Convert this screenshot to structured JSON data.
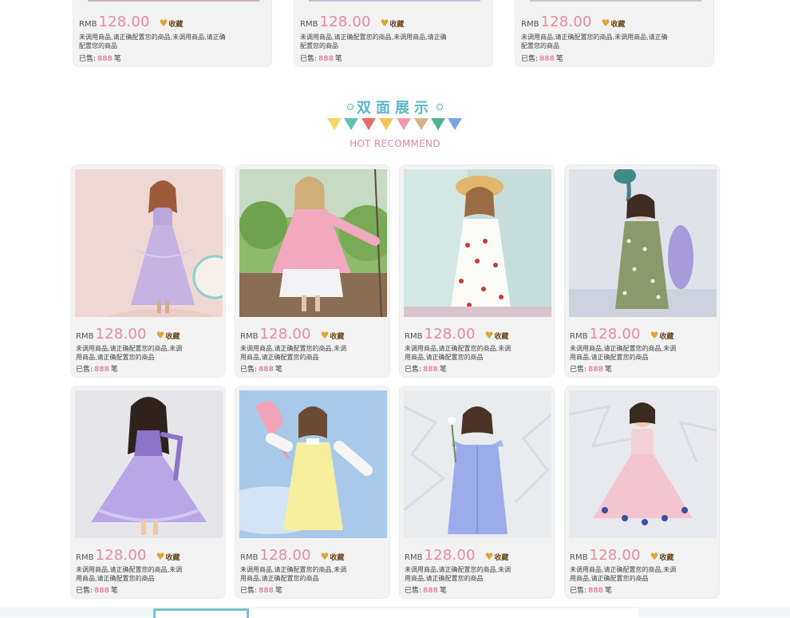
{
  "colors": {
    "price_pink": "#e98aa0",
    "title_teal": "#5ab8c7",
    "card_bg": "#f3f3f3",
    "fav_gold": "#e0a33a"
  },
  "section": {
    "title": "双面展示",
    "subtitle": "HOT RECOMMEND"
  },
  "product_common": {
    "currency": "RMB",
    "price": "128.00",
    "fav_label": "收藏",
    "desc_short": "未调用商品,请正确配置您的商品,未调用商品,请正确配置您的商品",
    "desc_long": "未调用商品,请正确配置您的商品,未调用商品,请正确配置您的商品",
    "sold_prefix": "已售:",
    "sold_count": "888",
    "sold_suffix": "笔"
  },
  "top_row": [
    {
      "id": "top-1"
    },
    {
      "id": "top-2"
    },
    {
      "id": "top-3"
    }
  ],
  "grid_row_1": [
    {
      "id": "dress-lavender"
    },
    {
      "id": "jacket-pink"
    },
    {
      "id": "dress-cherry"
    },
    {
      "id": "dress-floral"
    }
  ],
  "grid_row_2": [
    {
      "id": "dress-purple-tulle"
    },
    {
      "id": "dress-yellow"
    },
    {
      "id": "dress-blue"
    },
    {
      "id": "dress-pink-tulle"
    }
  ]
}
